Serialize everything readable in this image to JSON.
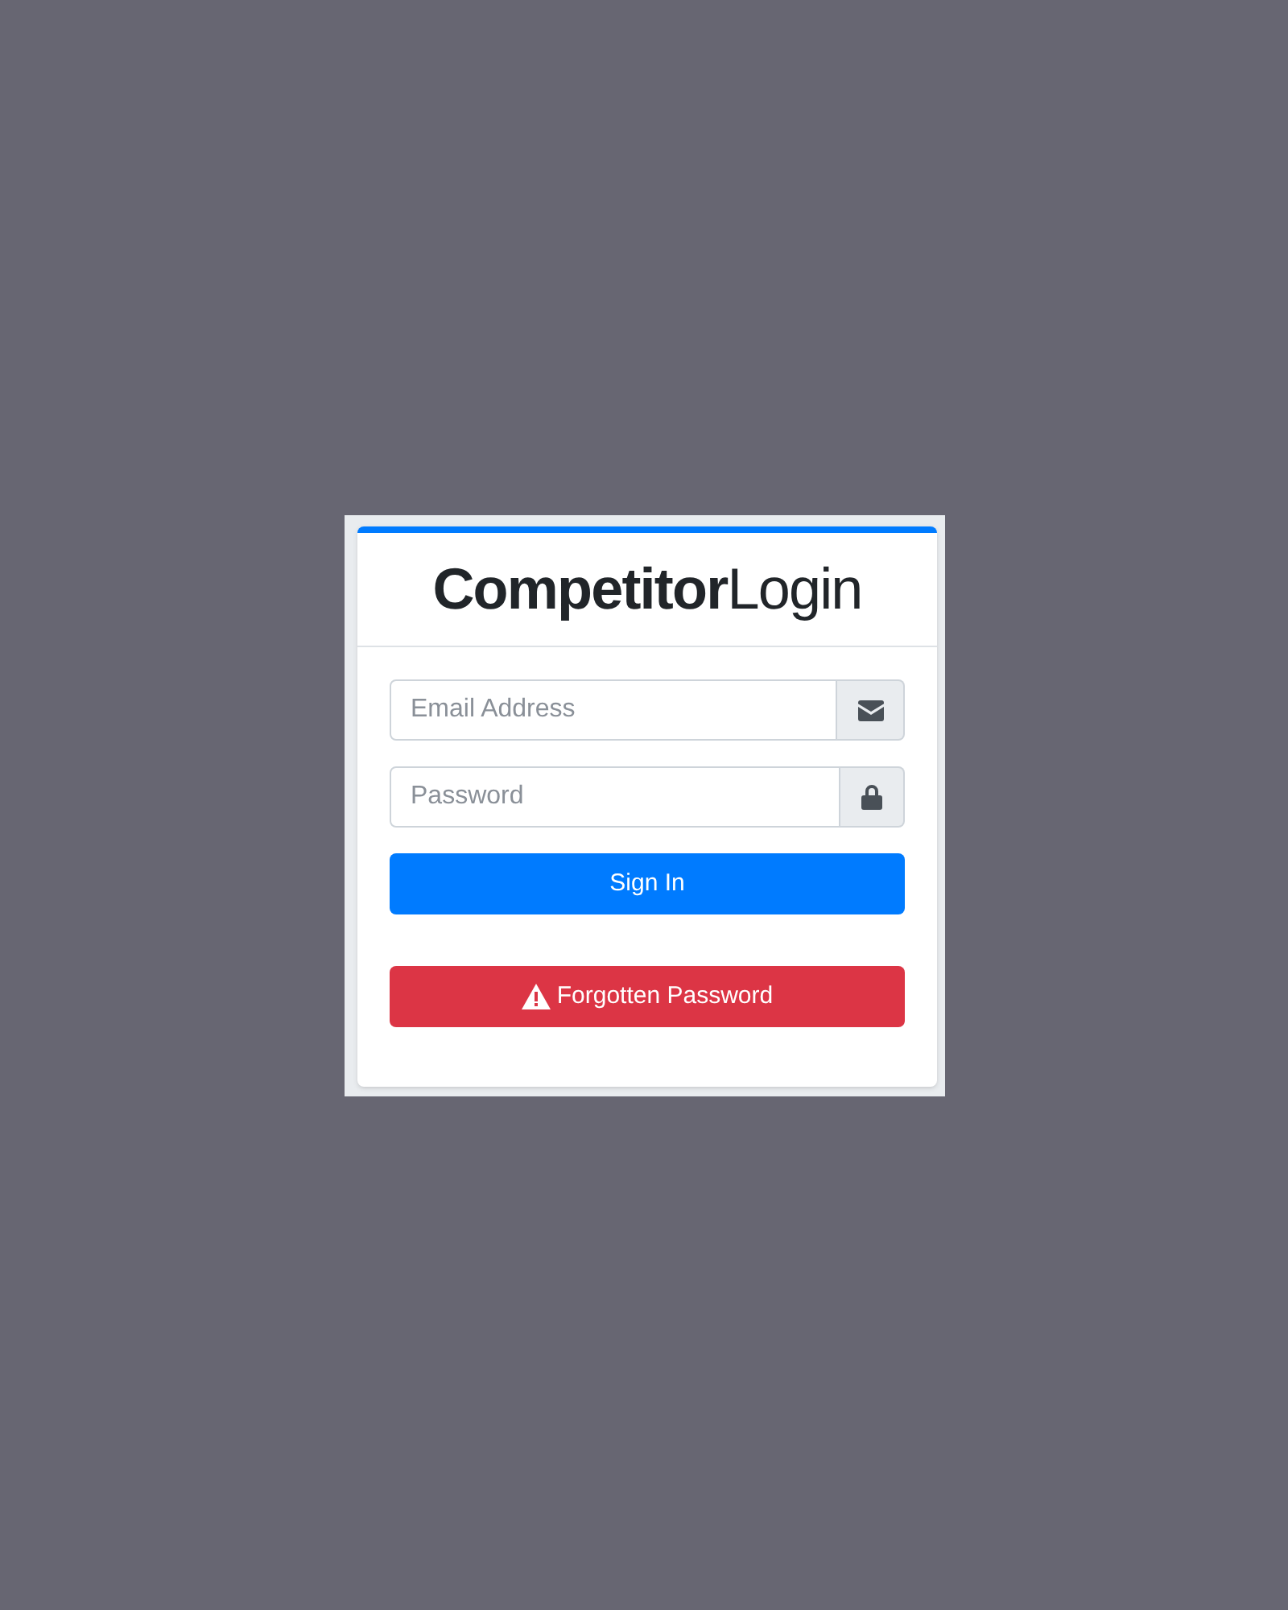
{
  "card": {
    "title": "**Competitor**Login"
  },
  "fields": [
    {
      "kind": "email",
      "placeholder": "Email Address"
    },
    {
      "kind": "password",
      "placeholder": "Password"
    }
  ],
  "buttons": [
    {
      "kind": "primary",
      "label": "Sign In"
    },
    {
      "kind": "danger",
      "label": "Forgotten Password"
    }
  ]
}
